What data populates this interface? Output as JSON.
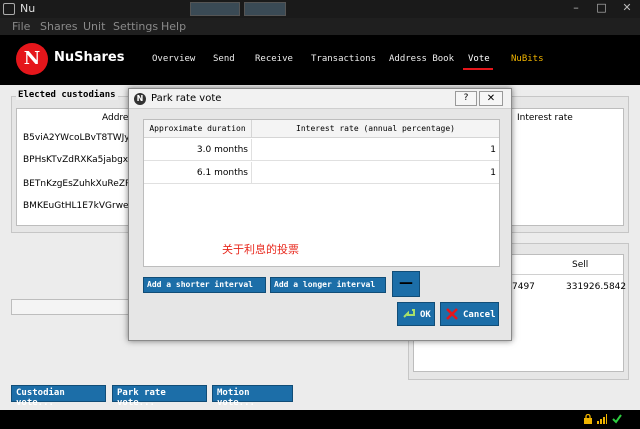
{
  "window": {
    "title": "Nu",
    "controls": {
      "minimize": "–",
      "maximize": "□",
      "close": "✕"
    }
  },
  "menu": [
    "File",
    "Shares",
    "Unit",
    "Settings",
    "Help"
  ],
  "brand": {
    "logo_letter": "N",
    "name": "NuShares",
    "accent": "#e5161b"
  },
  "nav": {
    "tabs": [
      "Overview",
      "Send",
      "Receive",
      "Transactions",
      "Address Book",
      "Vote",
      "NuBits"
    ],
    "active": "Vote",
    "nubits_color": "#f0b400"
  },
  "elected": {
    "label": "Elected custodians",
    "col_address": "Address",
    "col_interest": "Interest rate",
    "rows": [
      "B5viA2YWcoLBvT8TWJyw",
      "BPHsKTvZdRXKa5jabgxw",
      "BETnKzgEsZuhkXuReZRS",
      "BMKEuGtHL1E7kVGrweG"
    ]
  },
  "park_table": {
    "col_sell": "Sell",
    "row": {
      "buy": "7497",
      "sell": "331926.5842"
    }
  },
  "bottom_buttons": {
    "custodian": "Custodian vote...",
    "park": "Park rate vote...",
    "motion": "Motion vote..."
  },
  "dialog": {
    "title": "Park rate vote",
    "help": "?",
    "close": "✕",
    "columns": {
      "duration": "Approximate duration",
      "rate": "Interest rate (annual percentage)"
    },
    "rows": [
      {
        "duration": "3.0 months",
        "rate": "1"
      },
      {
        "duration": "6.1 months",
        "rate": "1"
      }
    ],
    "annotation": "关于利息的投票",
    "shorter_btn": "Add a shorter interval",
    "longer_btn": "Add a longer interval",
    "remove_btn": "—",
    "ok_btn": "OK",
    "cancel_btn": "Cancel",
    "button_color": "#1c6ea8"
  },
  "icons": {
    "lock": "lock-icon",
    "signal": "signal-icon",
    "check": "check-icon"
  }
}
